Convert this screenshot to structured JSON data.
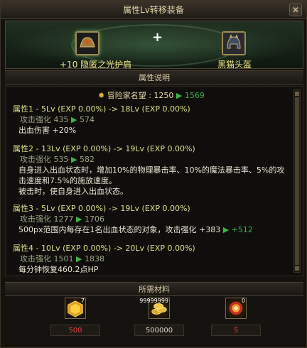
{
  "window": {
    "title": "属性Lv转移装备",
    "close_glyph": "✕"
  },
  "banner": {
    "source_item": "+10 隐匿之光护肩",
    "target_item": "黑猫头盔",
    "plus": "+"
  },
  "description": {
    "header": "属性说明",
    "reputation": {
      "label": "冒险家名望",
      "from": "1250",
      "to": "1569"
    },
    "attributes": [
      {
        "head": "属性1 - 5Lv (EXP 0.00%) -> 18Lv (EXP 0.00%)",
        "sub_label": "攻击强化",
        "sub_from": "435",
        "sub_to": "574",
        "body": [
          "出血伤害 +20%"
        ]
      },
      {
        "head": "属性2 - 13Lv (EXP 0.00%) -> 19Lv (EXP 0.00%)",
        "sub_label": "攻击强化",
        "sub_from": "535",
        "sub_to": "582",
        "body": [
          "自身进入出血状态时，增加10%的物理暴击率、10%的魔法暴击率、5%的攻",
          "击速度和7.5%的施放速度。",
          "被击时，使自身进入出血状态。"
        ]
      },
      {
        "head": "属性3 - 5Lv (EXP 0.00%) -> 19Lv (EXP 0.00%)",
        "sub_label": "攻击强化",
        "sub_from": "1277",
        "sub_to": "1706",
        "body_main": "500px范围内每存在1名出血状态的对象，攻击强化",
        "body_from": "+383",
        "body_to": "+512"
      },
      {
        "head": "属性4 - 10Lv (EXP 0.00%) -> 20Lv (EXP 0.00%)",
        "sub_label": "攻击强化",
        "sub_from": "1501",
        "sub_to": "1838",
        "body": [
          "每分钟恢复460.2点HP"
        ]
      }
    ]
  },
  "materials": {
    "header": "所需材料",
    "items": [
      {
        "icon": "golden-box-icon",
        "badge": "7",
        "quantity": "500",
        "quantity_color": "#e03b3b"
      },
      {
        "icon": "gold-coins-icon",
        "badge": "99999999",
        "quantity": "500000",
        "quantity_color": "#dcd6c6"
      },
      {
        "icon": "red-orb-icon",
        "badge": "0",
        "quantity": "5",
        "quantity_color": "#e03b3b"
      }
    ]
  }
}
